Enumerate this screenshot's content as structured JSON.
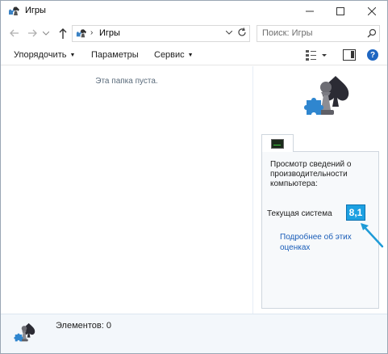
{
  "window": {
    "title": "Игры",
    "minimize": "—",
    "maximize": "☐",
    "close": "✕"
  },
  "address_bar": {
    "path_separator": "›",
    "path": "Игры",
    "search_placeholder": "Поиск: Игры"
  },
  "toolbar": {
    "organize": "Упорядочить",
    "parameters": "Параметры",
    "service": "Сервис",
    "help": "?"
  },
  "content": {
    "empty_message": "Эта папка пуста."
  },
  "performance_panel": {
    "heading": "Просмотр сведений о производительности компьютера:",
    "current_system_label": "Текущая система",
    "score": "8,1",
    "details_link": "Подробнее об этих оценках",
    "score_color": "#1da1e2",
    "arrow_color": "#1e9bd7"
  },
  "statusbar": {
    "items_text": "Элементов: 0"
  }
}
